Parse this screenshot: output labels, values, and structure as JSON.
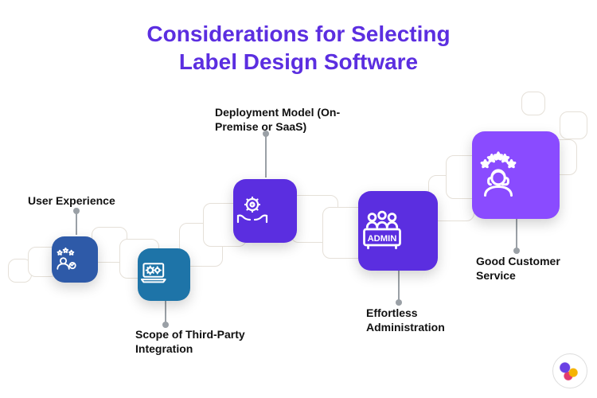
{
  "title_line1": "Considerations for Selecting",
  "title_line2": "Label Design Software",
  "nodes": {
    "ux": {
      "label": "User Experience",
      "color": "#2E5AA8",
      "icon": "user-stars"
    },
    "scope": {
      "label": "Scope of Third-Party Integration",
      "color": "#1E74A8",
      "icon": "laptop-gears"
    },
    "deploy": {
      "label": "Deployment Model (On-Premise or SaaS)",
      "color": "#5B2EE0",
      "icon": "hands-gear"
    },
    "admin": {
      "label": "Effortless Administration",
      "color": "#5B2EE0",
      "icon": "admin-panel"
    },
    "support": {
      "label": "Good Customer Service",
      "color": "#8A4BFF",
      "icon": "support-stars"
    }
  }
}
